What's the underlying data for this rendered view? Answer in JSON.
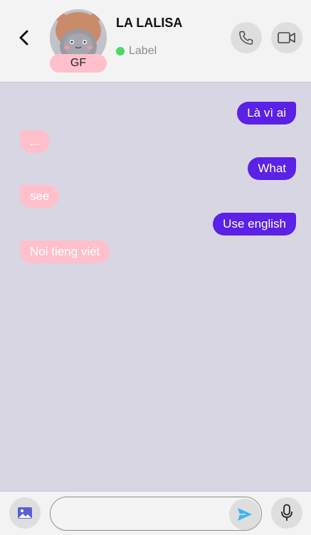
{
  "header": {
    "contact_name": "LA LALISA",
    "badge": "GF",
    "status_label": "Label"
  },
  "messages": [
    {
      "from": "me",
      "text": "Là vì ai"
    },
    {
      "from": "them",
      "text": "..."
    },
    {
      "from": "me",
      "text": "What"
    },
    {
      "from": "them",
      "text": "see"
    },
    {
      "from": "me",
      "text": "Use english"
    },
    {
      "from": "them",
      "text": "Noi tieng viet"
    }
  ],
  "composer": {
    "placeholder": ""
  },
  "colors": {
    "sent_bubble": "#5b21e6",
    "received_bubble": "#ffc0cb",
    "online": "#4cd964",
    "send_icon": "#3eb4f0"
  },
  "icons": [
    "chevron-left-icon",
    "phone-icon",
    "video-camera-icon",
    "image-icon",
    "send-icon",
    "microphone-icon"
  ]
}
